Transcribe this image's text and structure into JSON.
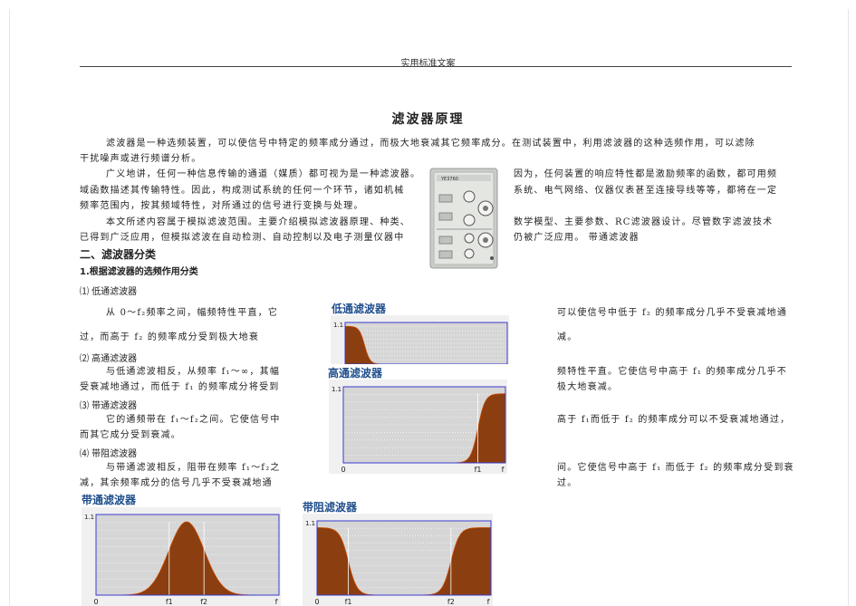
{
  "header": {
    "text": "实用标准文案"
  },
  "title": "滤波器原理",
  "paragraphs": {
    "p1_l1": "滤波器是一种选频装置，可以使信号中特定的频率成分通过，而极大地衰减其它频率成分。在测试装置中，利用滤波器的这种选频作用，可以滤除",
    "p1_l2": "干扰噪声或进行频谱分析。",
    "p2_l1_left": "广义地讲，任何一种信息传输的通道（媒质）都可视为是一种滤波器。",
    "p2_l1_right": "因为，任何装置的响应特性都是激励频率的函数，都可用频",
    "p2_l2_left": "域函数描述其传输特性。因此，构成测试系统的任何一个环节，诸如机械",
    "p2_l2_right": "系统、电气网络、仪器仪表甚至连接导线等等，都将在一定",
    "p2_l3_left": "频率范围内，按其频域特性，对所通过的信号进行变换与处理。",
    "p3_l1_left": "本文所述内容属于模拟滤波范围。主要介绍模拟滤波器原理、种类、",
    "p3_l1_right": "数学模型、主要参数、RC滤波器设计。尽管数字滤波技术",
    "p3_l2_left": "已得到广泛应用，但模拟滤波在自动检测、自动控制以及电子测量仪器中",
    "p3_l2_right": "仍被广泛应用。   带通滤波器"
  },
  "section2": {
    "heading": "二、滤波器分类",
    "sub1": "1.根据滤波器的选频作用分类"
  },
  "items": {
    "i1_title": "⑴   低通滤波器",
    "i1_l1_left": "从 0～f₂频率之间，幅频特性平直，它",
    "i1_l1_right": "可以使信号中低于  f₂ 的频率成分几乎不受衰减地通",
    "i1_l2_left": "过，而高于   f₂ 的频率成分受到极大地衰",
    "i1_l2_right": "减。",
    "i2_title": "⑵   高通滤波器",
    "i2_l1_left": "与低通滤波相反，从频率  f₁～∞，其幅",
    "i2_l1_right": "频特性平直。它使信号中高于 f₁ 的频率成分几乎不",
    "i2_l2_left": "受衰减地通过，而低于 f₁ 的频率成分将受到",
    "i2_l2_right": "极大地衰减。",
    "i3_title": "⑶   带通滤波器",
    "i3_l1_left": "它的通频带在  f₁～f₂之间。它使信号中",
    "i3_l1_right": "高于 f₁而低于 f₂ 的频率成分可以不受衰减地通过，",
    "i3_l2_left": "而其它成分受到衰减。",
    "i4_title": "⑷   带阻滤波器",
    "i4_l1_left": "与带通滤波相反，阻带在频率  f₁～f₂之",
    "i4_l1_right": "间。它使信号中高于  f₁ 而低于  f₂ 的频率成分受到衰",
    "i4_l2_left": "减，其余频率成分的信号几乎不受衰减地通",
    "i4_l2_right": "过。"
  },
  "device": {
    "label": "YE3760"
  },
  "colors": {
    "fill": "#8b3e0f",
    "frame": "#3a3ad0",
    "plot_bg": "#d6d6d6",
    "grid": "#ffffff",
    "title_blue": "#1f4e8c"
  },
  "chart_data": [
    {
      "id": "lowpass",
      "type": "area",
      "title": "低通滤波器",
      "ytick": "1.1",
      "xticks": [
        "",
        "",
        ""
      ],
      "ylim": [
        0,
        1.1
      ],
      "fill": "#8b3e0f",
      "response": "lowpass",
      "f1": 0.12,
      "f2": 0.12
    },
    {
      "id": "highpass",
      "type": "area",
      "title": "高通滤波器",
      "ytick": "1.1",
      "xticks": [
        "0",
        "f1",
        "f"
      ],
      "ylim": [
        0,
        1.1
      ],
      "fill": "#8b3e0f",
      "response": "highpass",
      "f1": 0.83,
      "f2": 0.83
    },
    {
      "id": "bandpass",
      "type": "area",
      "title": "带通滤波器",
      "ytick": "1.1",
      "xticks": [
        "0",
        "f1",
        "f2",
        "f"
      ],
      "ylim": [
        0,
        1.1
      ],
      "fill": "#8b3e0f",
      "response": "bandpass",
      "f1": 0.4,
      "f2": 0.59
    },
    {
      "id": "bandstop",
      "type": "area",
      "title": "带阻滤波器",
      "ytick": "1.1",
      "xticks": [
        "0",
        "f1",
        "f2",
        "f"
      ],
      "ylim": [
        0,
        1.1
      ],
      "fill": "#8b3e0f",
      "response": "bandstop",
      "f1": 0.18,
      "f2": 0.77
    }
  ]
}
